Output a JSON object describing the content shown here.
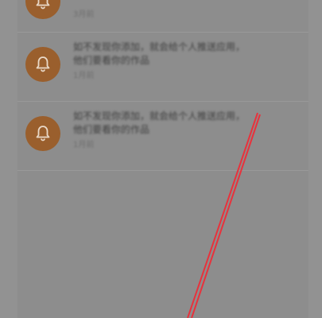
{
  "notifications": [
    {
      "line1": "",
      "line2": "",
      "time": "3月前",
      "icon": "bell-icon"
    },
    {
      "line1": "如不发现你添加，就会给个人推送应用，",
      "line2": "他们要看你的作品",
      "time": "1月前",
      "icon": "bell-icon"
    },
    {
      "line1": "如不发现你添加，就会给个人推送应用，",
      "line2": "他们要看你的作品",
      "time": "1月前",
      "icon": "bell-icon"
    }
  ],
  "colors": {
    "overlay": "#8d8d8d",
    "bell_bg": "#9a5f2d",
    "annotation": "#e8323c"
  }
}
